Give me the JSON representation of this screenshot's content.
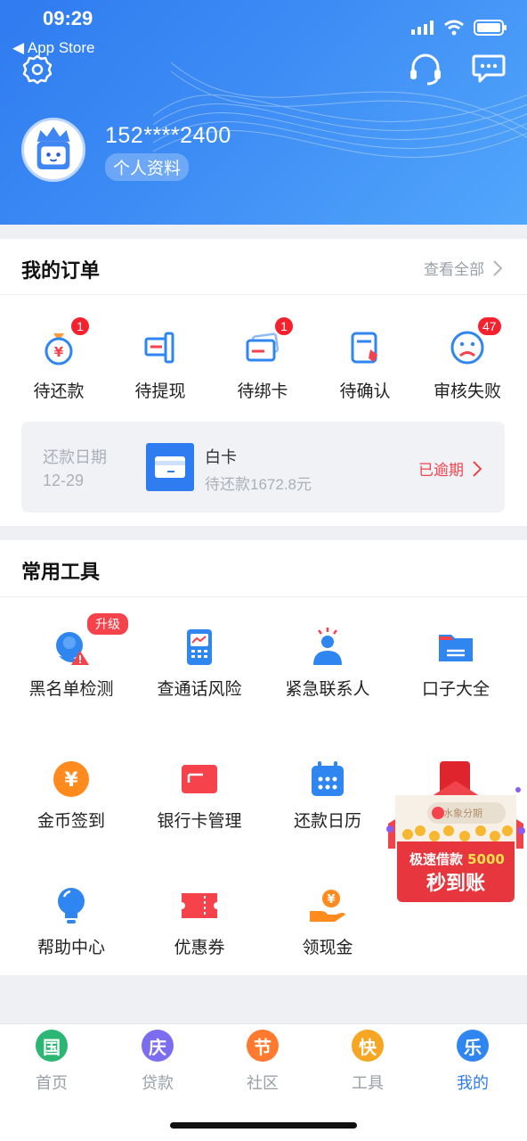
{
  "status_bar": {
    "time": "09:29",
    "back_app": "◀ App Store"
  },
  "profile": {
    "phone": "152****2400",
    "profile_label": "个人资料"
  },
  "orders": {
    "title": "我的订单",
    "see_all": "查看全部",
    "items": [
      {
        "label": "待还款",
        "badge": "1",
        "icon": "money-bag-icon"
      },
      {
        "label": "待提现",
        "badge": "",
        "icon": "withdraw-icon"
      },
      {
        "label": "待绑卡",
        "badge": "1",
        "icon": "bind-card-icon"
      },
      {
        "label": "待确认",
        "badge": "",
        "icon": "confirm-doc-icon"
      },
      {
        "label": "审核失败",
        "badge": "47",
        "icon": "sad-face-icon"
      }
    ],
    "repayment": {
      "date_label": "还款日期",
      "date_value": "12-29",
      "card_name": "白卡",
      "amount_text": "待还款1672.8元",
      "status": "已逾期"
    }
  },
  "tools": {
    "title": "常用工具",
    "upgrade_badge": "升级",
    "items": [
      {
        "label": "黑名单检测",
        "icon": "blacklist-check-icon"
      },
      {
        "label": "查通话风险",
        "icon": "call-risk-icon"
      },
      {
        "label": "紧急联系人",
        "icon": "emergency-contact-icon"
      },
      {
        "label": "口子大全",
        "icon": "folder-icon"
      },
      {
        "label": "金币签到",
        "icon": "coin-icon"
      },
      {
        "label": "银行卡管理",
        "icon": "bank-card-icon"
      },
      {
        "label": "还款日历",
        "icon": "calendar-icon"
      },
      {
        "label": "帮助中心",
        "icon": "lightbulb-icon"
      },
      {
        "label": "优惠券",
        "icon": "coupon-icon"
      },
      {
        "label": "领现金",
        "icon": "cash-hand-icon"
      }
    ]
  },
  "promo": {
    "brand": "水象分期",
    "line1": "极速借款",
    "amount": "5000",
    "line2": "秒到账"
  },
  "tabbar": [
    {
      "label": "首页",
      "glyph": "国",
      "color": "#2bb673"
    },
    {
      "label": "贷款",
      "glyph": "庆",
      "color": "#7b6cf0"
    },
    {
      "label": "社区",
      "glyph": "节",
      "color": "#ff7a2e"
    },
    {
      "label": "工具",
      "glyph": "快",
      "color": "#f6a623"
    },
    {
      "label": "我的",
      "glyph": "乐",
      "color": "#2f86f0"
    }
  ],
  "colors": {
    "primary": "#2f7bf0",
    "badge_red": "#f5222d",
    "overdue": "#f0444c"
  }
}
